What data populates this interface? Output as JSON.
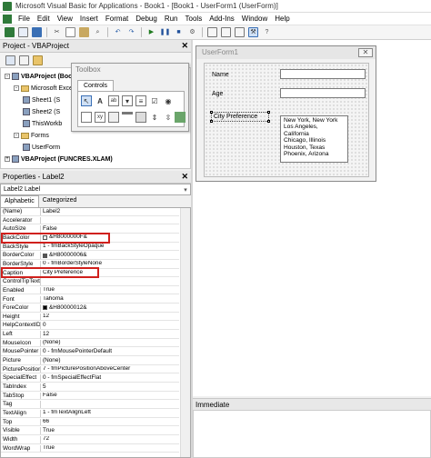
{
  "window": {
    "title": "Microsoft Visual Basic for Applications - Book1 - [Book1 - UserForm1 (UserForm)]"
  },
  "menu": [
    "File",
    "Edit",
    "View",
    "Insert",
    "Format",
    "Debug",
    "Run",
    "Tools",
    "Add-Ins",
    "Window",
    "Help"
  ],
  "project": {
    "title": "Project - VBAProject",
    "close": "✕",
    "tree": [
      {
        "label": "VBAProject (Boo",
        "indent": 0,
        "kind": "proj",
        "pm": "-"
      },
      {
        "label": "Microsoft Exce",
        "indent": 1,
        "kind": "folder",
        "pm": "-"
      },
      {
        "label": "Sheet1 (S",
        "indent": 2,
        "kind": "item"
      },
      {
        "label": "Sheet2 (S",
        "indent": 2,
        "kind": "item"
      },
      {
        "label": "ThisWorkb",
        "indent": 2,
        "kind": "item"
      },
      {
        "label": "Forms",
        "indent": 1,
        "kind": "folder",
        "pm": "-"
      },
      {
        "label": "UserForm",
        "indent": 2,
        "kind": "item"
      },
      {
        "label": "VBAProject (FUNCRES.XLAM)",
        "indent": 0,
        "kind": "proj",
        "pm": "+"
      }
    ]
  },
  "toolbox": {
    "title": "Toolbox",
    "tab": "Controls"
  },
  "properties": {
    "title": "Properties - Label2",
    "close": "✕",
    "object": "Label2 Label",
    "tabs": [
      "Alphabetic",
      "Categorized"
    ],
    "rows": [
      {
        "k": "(Name)",
        "v": "Label2"
      },
      {
        "k": "Accelerator",
        "v": ""
      },
      {
        "k": "AutoSize",
        "v": "False"
      },
      {
        "k": "BackColor",
        "v": "&H8000000F&",
        "swatch": "#f0f0f0"
      },
      {
        "k": "BackStyle",
        "v": "1 - fmBackStyleOpaque"
      },
      {
        "k": "BorderColor",
        "v": "&H80000006&",
        "swatch": "#555555"
      },
      {
        "k": "BorderStyle",
        "v": "0 - fmBorderStyleNone"
      },
      {
        "k": "Caption",
        "v": "City Preference"
      },
      {
        "k": "ControlTipText",
        "v": ""
      },
      {
        "k": "Enabled",
        "v": "True"
      },
      {
        "k": "Font",
        "v": "Tahoma"
      },
      {
        "k": "ForeColor",
        "v": "&H80000012&",
        "swatch": "#000000"
      },
      {
        "k": "Height",
        "v": "12"
      },
      {
        "k": "HelpContextID",
        "v": "0"
      },
      {
        "k": "Left",
        "v": "12"
      },
      {
        "k": "MouseIcon",
        "v": "(None)"
      },
      {
        "k": "MousePointer",
        "v": "0 - fmMousePointerDefault"
      },
      {
        "k": "Picture",
        "v": "(None)"
      },
      {
        "k": "PicturePosition",
        "v": "7 - fmPicturePositionAboveCenter"
      },
      {
        "k": "SpecialEffect",
        "v": "0 - fmSpecialEffectFlat"
      },
      {
        "k": "TabIndex",
        "v": "5"
      },
      {
        "k": "TabStop",
        "v": "False"
      },
      {
        "k": "Tag",
        "v": ""
      },
      {
        "k": "TextAlign",
        "v": "1 - fmTextAlignLeft"
      },
      {
        "k": "Top",
        "v": "66"
      },
      {
        "k": "Visible",
        "v": "True"
      },
      {
        "k": "Width",
        "v": "72"
      },
      {
        "k": "WordWrap",
        "v": "True"
      }
    ]
  },
  "userform": {
    "title": "UserForm1",
    "close": "✕",
    "labels": {
      "name": "Name",
      "age": "Age",
      "city": "City Preference"
    },
    "cities": [
      "New York, New York",
      "Los Angeles, California",
      "Chicago, Illinois",
      "Houston, Texas",
      "Phoenix, Arizona"
    ]
  },
  "immediate": {
    "title": "Immediate"
  },
  "colors": {
    "highlight": "#d0201c",
    "excel_green": "#2f7a3a"
  }
}
